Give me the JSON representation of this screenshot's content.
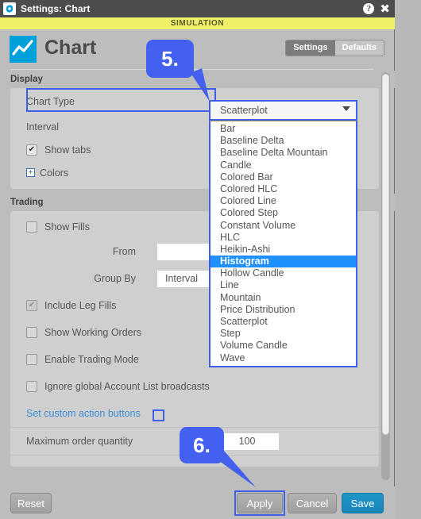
{
  "titlebar": {
    "app_icon": "settings-gear-icon",
    "title": "Settings: Chart",
    "help_icon": "?",
    "close_icon": "✖"
  },
  "simulation_banner": {
    "text": "SIMULATION",
    "color": "#f0f067"
  },
  "header": {
    "icon": "line-chart-icon",
    "title": "Chart",
    "accent_color": "#00a0db",
    "segmented": {
      "settings_label": "Settings",
      "defaults_label": "Defaults",
      "active": "Settings"
    }
  },
  "sections": [
    {
      "name": "display",
      "heading": "Display",
      "rows": [
        {
          "type": "select",
          "label": "Chart Type",
          "value": "Scatterplot",
          "highlighted": true
        },
        {
          "type": "select",
          "label": "Interval",
          "value": ""
        },
        {
          "type": "checkbox",
          "label": "Show tabs",
          "checked": true
        },
        {
          "type": "expander",
          "label": "Colors",
          "glyph": "+"
        }
      ]
    },
    {
      "name": "trading",
      "heading": "Trading",
      "rows": [
        {
          "type": "checkbox",
          "label": "Show Fills",
          "checked": false
        },
        {
          "type": "text",
          "label": "From",
          "value": ""
        },
        {
          "type": "select",
          "label": "Group By",
          "value": "Interval"
        },
        {
          "type": "checkbox",
          "label": "Include Leg Fills",
          "checked": true,
          "disabled": true
        },
        {
          "type": "checkbox",
          "label": "Show Working Orders",
          "checked": false
        },
        {
          "type": "checkbox",
          "label": "Enable Trading Mode",
          "checked": false
        },
        {
          "type": "checkbox",
          "label": "Ignore global Account List broadcasts",
          "checked": false
        },
        {
          "type": "link",
          "label": "Set custom action buttons"
        },
        {
          "type": "number",
          "label": "Maximum order quantity",
          "value": "100"
        }
      ]
    }
  ],
  "dropdown": {
    "selected_display": "Scatterplot",
    "caret_icon": "chevron-down-icon",
    "highlighted_option": "Histogram",
    "highlight_color": "#1e90ff",
    "options": [
      "Bar",
      "Baseline Delta",
      "Baseline Delta Mountain",
      "Candle",
      "Colored Bar",
      "Colored HLC",
      "Colored Line",
      "Colored Step",
      "Constant Volume",
      "HLC",
      "Heikin-Ashi",
      "Histogram",
      "Hollow Candle",
      "Line",
      "Mountain",
      "Price Distribution",
      "Scatterplot",
      "Step",
      "Volume Candle",
      "Wave"
    ]
  },
  "footer": {
    "reset_label": "Reset",
    "apply_label": "Apply",
    "cancel_label": "Cancel",
    "save_label": "Save",
    "save_color": "#1785ba",
    "apply_highlighted": true
  },
  "callouts": [
    {
      "id": "step-5",
      "text": "5.",
      "color": "#4361ee"
    },
    {
      "id": "step-6",
      "text": "6.",
      "color": "#4361ee"
    }
  ]
}
